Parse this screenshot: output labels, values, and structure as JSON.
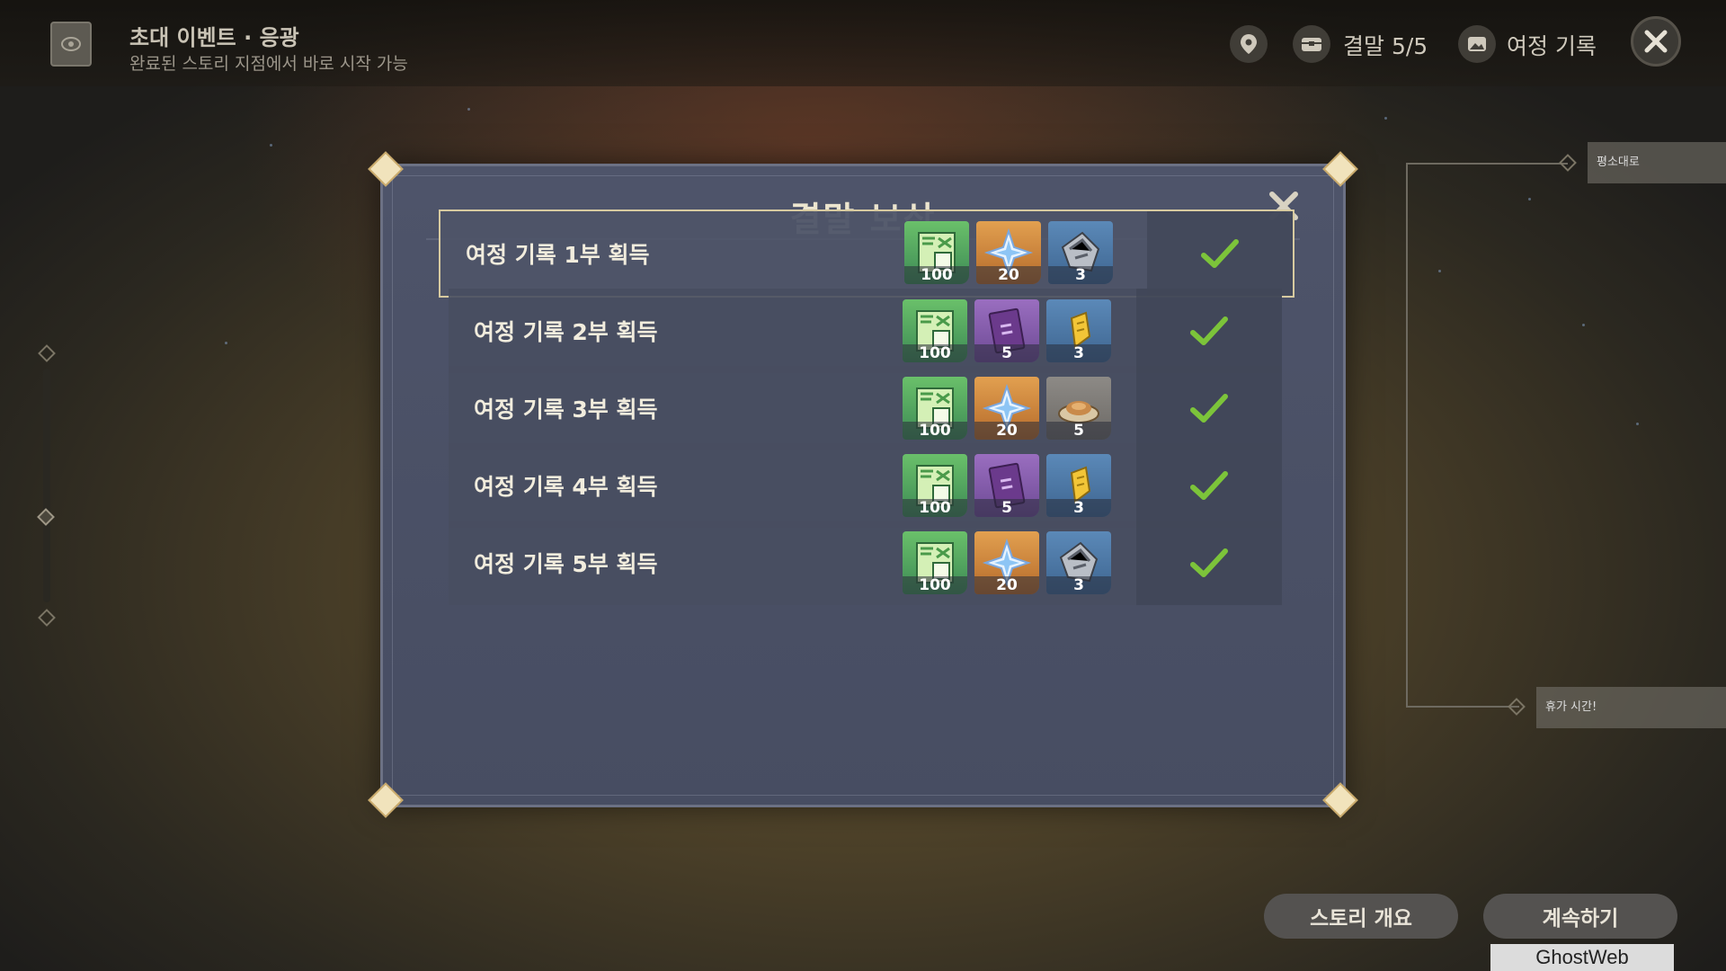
{
  "header": {
    "event_title": "초대 이벤트 · 응광",
    "event_subtitle": "완료된 스토리 지점에서 바로 시작 가능",
    "endings_label": "결말 5/5",
    "journey_label": "여정 기록"
  },
  "side": {
    "branch_top_label": "평소대로",
    "branch_bottom_label": "휴가 시간!"
  },
  "modal": {
    "title": "결말 보상",
    "rows": [
      {
        "label": "여정 기록 1부 획득",
        "items": [
          {
            "icon": "hero-wit-exp-icon",
            "count": "100"
          },
          {
            "icon": "primogem-icon",
            "count": "20"
          },
          {
            "icon": "mystic-enhancement-ore-icon",
            "count": "3"
          }
        ],
        "claimed": true
      },
      {
        "label": "여정 기록 2부 획득",
        "items": [
          {
            "icon": "hero-wit-exp-icon",
            "count": "100"
          },
          {
            "icon": "talent-book-icon",
            "count": "5"
          },
          {
            "icon": "fine-enhancement-ore-icon",
            "count": "3"
          }
        ],
        "claimed": true
      },
      {
        "label": "여정 기록 3부 획득",
        "items": [
          {
            "icon": "hero-wit-exp-icon",
            "count": "100"
          },
          {
            "icon": "primogem-icon",
            "count": "20"
          },
          {
            "icon": "dish-icon",
            "count": "5"
          }
        ],
        "claimed": true
      },
      {
        "label": "여정 기록 4부 획득",
        "items": [
          {
            "icon": "hero-wit-exp-icon",
            "count": "100"
          },
          {
            "icon": "talent-book-icon",
            "count": "5"
          },
          {
            "icon": "fine-enhancement-ore-icon",
            "count": "3"
          }
        ],
        "claimed": true
      },
      {
        "label": "여정 기록 5부 획득",
        "items": [
          {
            "icon": "hero-wit-exp-icon",
            "count": "100"
          },
          {
            "icon": "primogem-icon",
            "count": "20"
          },
          {
            "icon": "mystic-enhancement-ore-icon",
            "count": "3"
          }
        ],
        "claimed": true
      }
    ]
  },
  "footer": {
    "story_overview_label": "스토리 개요",
    "continue_label": "계속하기",
    "watermark": "GhostWeb"
  },
  "colors": {
    "accent_green": "#7cc43a",
    "panel": "#4b5166",
    "corner_gold": "#f1e3bc"
  }
}
